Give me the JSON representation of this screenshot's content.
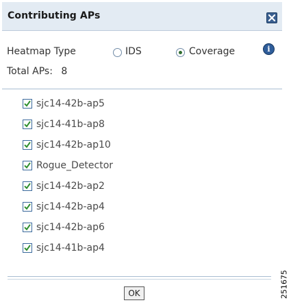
{
  "dialog": {
    "title": "Contributing APs",
    "close_icon": "close-x-icon",
    "colors": {
      "titlebar_bg": "#e3ebf3",
      "close_button": "#3a5f8f",
      "check_mark": "#2f8f2f",
      "separator": "#a9bdd2"
    }
  },
  "heatmap": {
    "label": "Heatmap Type",
    "options": [
      {
        "label": "IDS",
        "selected": false
      },
      {
        "label": "Coverage",
        "selected": true
      }
    ],
    "info_icon": "info-icon",
    "info_glyph": "i"
  },
  "total": {
    "label": "Total APs:",
    "value": "8"
  },
  "aps": [
    {
      "name": "sjc14-42b-ap5",
      "checked": true
    },
    {
      "name": "sjc14-41b-ap8",
      "checked": true
    },
    {
      "name": "sjc14-42b-ap10",
      "checked": true
    },
    {
      "name": "Rogue_Detector",
      "checked": true
    },
    {
      "name": "sjc14-42b-ap2",
      "checked": true
    },
    {
      "name": "sjc14-42b-ap4",
      "checked": true
    },
    {
      "name": "sjc14-42b-ap6",
      "checked": true
    },
    {
      "name": "sjc14-41b-ap4",
      "checked": true
    }
  ],
  "footer": {
    "ok_label": "OK"
  },
  "figure_id": "251675"
}
